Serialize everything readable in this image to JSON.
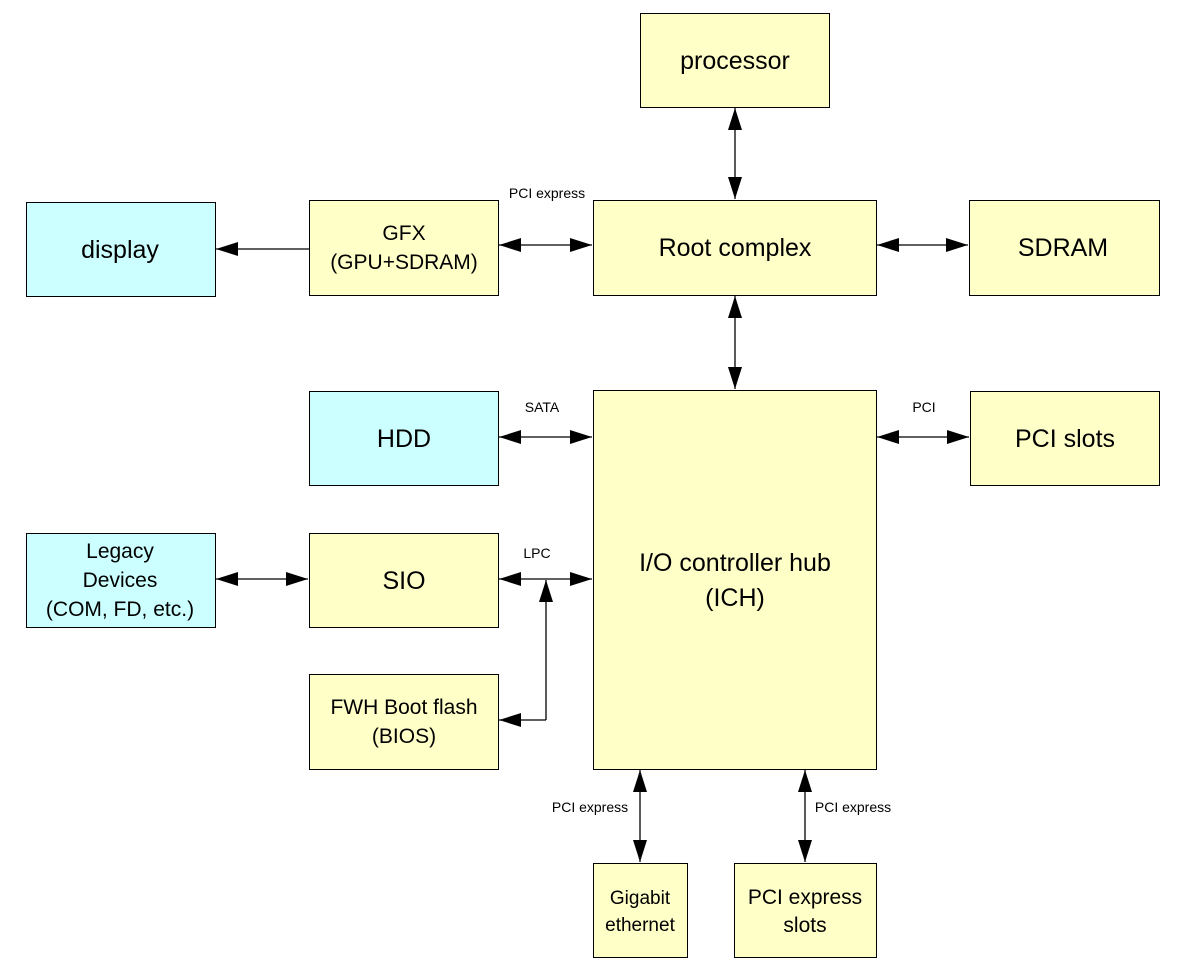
{
  "colors": {
    "component": "#ffffc8",
    "peripheral": "#ccffff",
    "line": "#000000"
  },
  "nodes": {
    "processor": "processor",
    "display": "display",
    "gfx": [
      "GFX",
      "(GPU+SDRAM)"
    ],
    "root_complex": "Root complex",
    "sdram": "SDRAM",
    "hdd": "HDD",
    "ich": [
      "I/O controller hub",
      "(ICH)"
    ],
    "pci_slots": "PCI slots",
    "legacy": [
      "Legacy",
      "Devices",
      "(COM, FD, etc.)"
    ],
    "sio": "SIO",
    "fwh": [
      "FWH Boot flash",
      "(BIOS)"
    ],
    "gigabit": [
      "Gigabit",
      "ethernet"
    ],
    "pcie_slots": [
      "PCI express",
      "slots"
    ]
  },
  "bus_labels": {
    "gfx_root": "PCI express",
    "sata": "SATA",
    "pci": "PCI",
    "lpc": "LPC",
    "pcie_gigabit": "PCI express",
    "pcie_slots": "PCI express"
  }
}
